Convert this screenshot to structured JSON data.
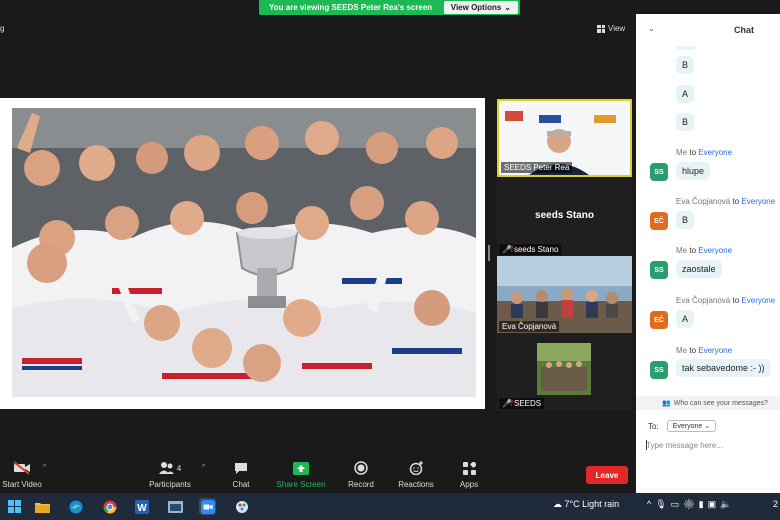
{
  "banner": {
    "text": "You are viewing SEEDS Peter Rea's screen",
    "options_label": "View Options"
  },
  "top_left_text": "g",
  "view_label": "View",
  "tiles": [
    {
      "name": "SEEDS Peter Rea"
    },
    {
      "big_name": "seeds  Stano",
      "name": "seeds  Stano"
    },
    {
      "name": "Eva Čopjanová"
    },
    {
      "name": "SEEDS"
    }
  ],
  "toolbar": {
    "start_video": "Start Video",
    "participants": "Participants",
    "participants_count": "4",
    "chat": "Chat",
    "share_screen": "Share Screen",
    "record": "Record",
    "reactions": "Reactions",
    "apps": "Apps",
    "leave": "Leave"
  },
  "chat": {
    "title": "Chat",
    "early_bubbles": [
      "B",
      "A",
      "B"
    ],
    "messages": [
      {
        "sender": "Me",
        "to_word": "to",
        "target": "Everyone",
        "avatar": "SS",
        "text": "hlupe"
      },
      {
        "sender": "Eva Čopjanová",
        "to_word": "to",
        "target": "Everyone",
        "avatar": "EČ",
        "text": "B"
      },
      {
        "sender": "Me",
        "to_word": "to",
        "target": "Everyone",
        "avatar": "SS",
        "text": "zaostale"
      },
      {
        "sender": "Eva Čopjanová",
        "to_word": "to",
        "target": "Everyone",
        "avatar": "EČ",
        "text": "A"
      },
      {
        "sender": "Me",
        "to_word": "to",
        "target": "Everyone",
        "avatar": "SS",
        "text": "tak sebavedome :- ))"
      }
    ],
    "who_can_see": "Who can see your messages?",
    "to_label": "To:",
    "recipient": "Everyone",
    "placeholder": "Type message here..."
  },
  "taskbar": {
    "weather_temp": "7°C",
    "weather_desc": "Light rain",
    "clock_partial": "2"
  },
  "colors": {
    "banner_green": "#1db954",
    "leave_red": "#e02828",
    "share_green": "#1db954",
    "everyone_blue": "#2d6cdf",
    "avatar_me": "#2a9d6f",
    "avatar_eva": "#e06a1d",
    "active_speaker": "#d6d42a"
  }
}
